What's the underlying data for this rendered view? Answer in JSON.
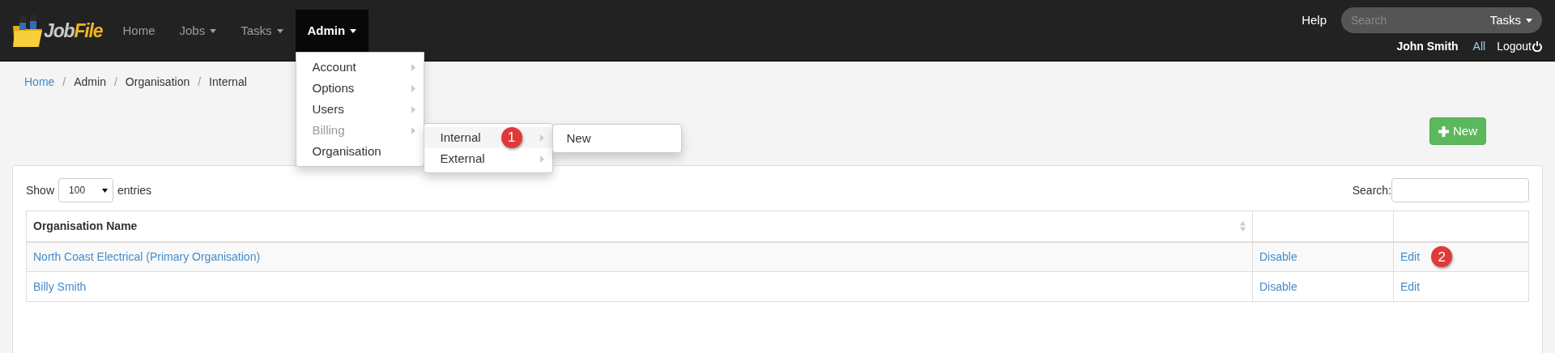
{
  "navbar": {
    "brand_first": "Job",
    "brand_second": "File",
    "items": [
      {
        "label": "Home",
        "caret": false,
        "selected": false
      },
      {
        "label": "Jobs",
        "caret": true,
        "selected": false
      },
      {
        "label": "Tasks",
        "caret": true,
        "selected": false
      },
      {
        "label": "Admin",
        "caret": true,
        "selected": true
      }
    ],
    "help": "Help",
    "search_placeholder": "Search",
    "search_scope": "Tasks",
    "user": "John Smith",
    "all": "All",
    "logout": "Logout"
  },
  "admin_menu": [
    {
      "label": "Account",
      "disabled": false,
      "submenu": true
    },
    {
      "label": "Options",
      "disabled": false,
      "submenu": true
    },
    {
      "label": "Users",
      "disabled": false,
      "submenu": true
    },
    {
      "label": "Billing",
      "disabled": true,
      "submenu": true
    },
    {
      "label": "Organisation",
      "disabled": false,
      "submenu": false
    }
  ],
  "organisation_menu": [
    {
      "label": "Internal",
      "selected": true
    },
    {
      "label": "External",
      "selected": false
    }
  ],
  "internal_menu": [
    "New"
  ],
  "callouts": [
    "1",
    "2"
  ],
  "breadcrumb": [
    {
      "label": "Home",
      "link": true
    },
    {
      "separator": "/",
      "label": "Admin",
      "link": false
    },
    {
      "separator": "/",
      "label": "Organisation",
      "link": false
    },
    {
      "separator": "/",
      "label": "Internal",
      "link": false
    }
  ],
  "new_button": "New",
  "table_controls": {
    "show_label": "Show",
    "page_size": "100",
    "entries_label": "entries",
    "search_label": "Search:"
  },
  "table": {
    "columns": [
      "Organisation Name"
    ],
    "rows": [
      {
        "name": "North Coast Electrical (Primary Organisation)",
        "disable": "Disable",
        "edit": "Edit"
      },
      {
        "name": "Billy Smith",
        "disable": "Disable",
        "edit": "Edit"
      }
    ]
  }
}
